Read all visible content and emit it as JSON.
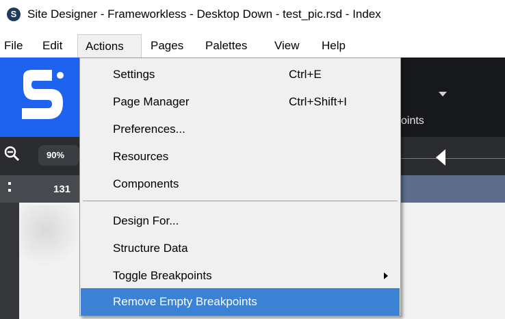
{
  "window": {
    "title": "Site Designer - Frameworkless - Desktop Down - test_pic.rsd - Index",
    "logo_letter": "S"
  },
  "menubar": {
    "items": [
      "File",
      "Edit",
      "Actions",
      "Pages",
      "Palettes",
      "View",
      "Help"
    ],
    "active": "Actions"
  },
  "app": {
    "ribbon_text": "oints",
    "zoom_value": "90%",
    "ruler_value": "131"
  },
  "dropdown": {
    "items": [
      {
        "label": "Settings",
        "shortcut": "Ctrl+E"
      },
      {
        "label": "Page Manager",
        "shortcut": "Ctrl+Shift+I"
      },
      {
        "label": "Preferences...",
        "shortcut": ""
      },
      {
        "label": "Resources",
        "shortcut": ""
      },
      {
        "label": "Components",
        "shortcut": ""
      },
      {
        "label": "Design For...",
        "shortcut": ""
      },
      {
        "label": "Structure Data",
        "shortcut": ""
      },
      {
        "label": "Toggle Breakpoints",
        "shortcut": "",
        "submenu": true
      },
      {
        "label": "Remove Empty Breakpoints",
        "shortcut": "",
        "highlighted": true
      }
    ]
  },
  "colors": {
    "highlight": "#3b82d4",
    "brand_blue": "#1e63f0"
  }
}
